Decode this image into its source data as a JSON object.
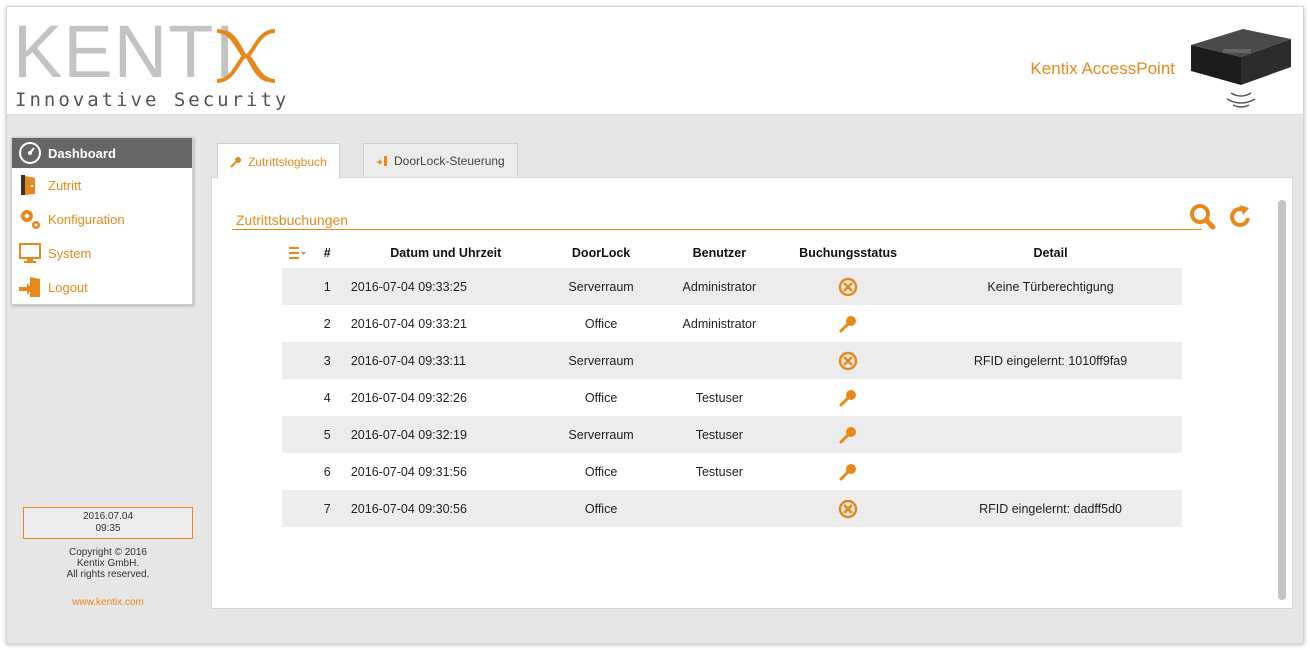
{
  "brand": {
    "logo_text": "KENTI",
    "tagline": "Innovative Security",
    "product_name": "Kentix AccessPoint",
    "accent_color": "#e6891a"
  },
  "sidebar": {
    "items": [
      {
        "label": "Dashboard",
        "icon": "gauge-icon",
        "active": true
      },
      {
        "label": "Zutritt",
        "icon": "door-icon",
        "active": false
      },
      {
        "label": "Konfiguration",
        "icon": "gears-icon",
        "active": false
      },
      {
        "label": "System",
        "icon": "monitor-icon",
        "active": false
      },
      {
        "label": "Logout",
        "icon": "logout-icon",
        "active": false
      }
    ],
    "clock_date": "2016.07.04",
    "clock_time": "09:35",
    "copyright_line1": "Copyright © 2016",
    "copyright_line2": "Kentix GmbH.",
    "copyright_line3": "All rights reserved.",
    "website": "www.kentix.com"
  },
  "tabs": [
    {
      "label": "Zutrittslogbuch",
      "icon": "key-icon",
      "active": true
    },
    {
      "label": "DoorLock-Steuerung",
      "icon": "door-arrow-icon",
      "active": false
    }
  ],
  "main": {
    "section_title": "Zutrittsbuchungen",
    "columns": [
      "#",
      "Datum und Uhrzeit",
      "DoorLock",
      "Benutzer",
      "Buchungsstatus",
      "Detail"
    ],
    "rows": [
      {
        "num": "1",
        "datetime": "2016-07-04 09:33:25",
        "doorlock": "Serverraum",
        "user": "Administrator",
        "status": "denied",
        "detail": "Keine Türberechtigung"
      },
      {
        "num": "2",
        "datetime": "2016-07-04 09:33:21",
        "doorlock": "Office",
        "user": "Administrator",
        "status": "granted",
        "detail": ""
      },
      {
        "num": "3",
        "datetime": "2016-07-04 09:33:11",
        "doorlock": "Serverraum",
        "user": "",
        "status": "denied",
        "detail": "RFID eingelernt: 1010ff9fa9"
      },
      {
        "num": "4",
        "datetime": "2016-07-04 09:32:26",
        "doorlock": "Office",
        "user": "Testuser",
        "status": "granted",
        "detail": ""
      },
      {
        "num": "5",
        "datetime": "2016-07-04 09:32:19",
        "doorlock": "Serverraum",
        "user": "Testuser",
        "status": "granted",
        "detail": ""
      },
      {
        "num": "6",
        "datetime": "2016-07-04 09:31:56",
        "doorlock": "Office",
        "user": "Testuser",
        "status": "granted",
        "detail": ""
      },
      {
        "num": "7",
        "datetime": "2016-07-04 09:30:56",
        "doorlock": "Office",
        "user": "",
        "status": "denied",
        "detail": "RFID eingelernt: dadff5d0"
      }
    ]
  }
}
